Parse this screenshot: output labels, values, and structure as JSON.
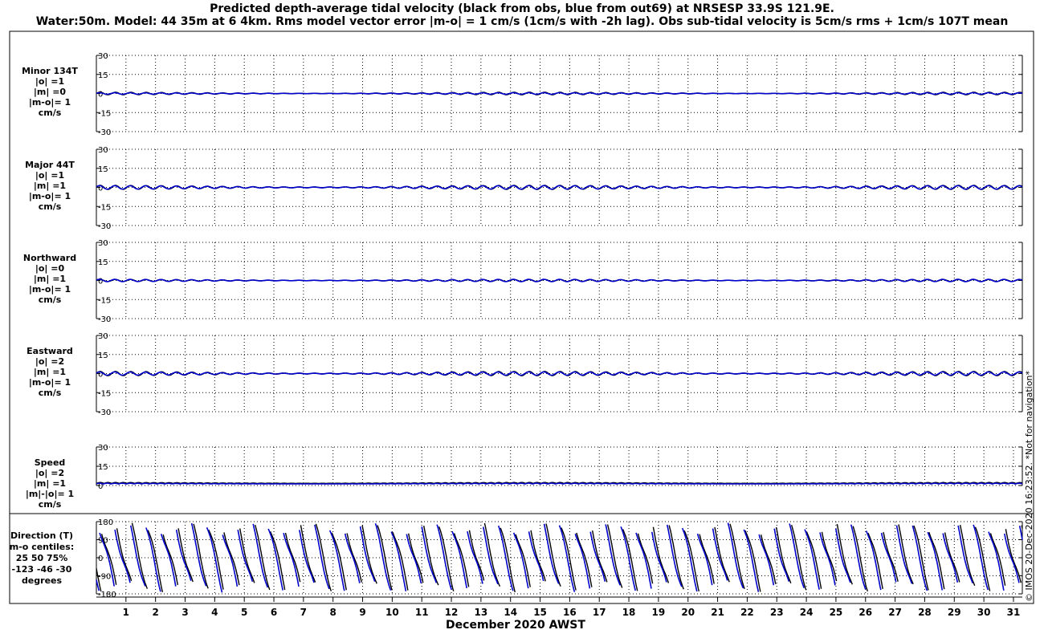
{
  "title": {
    "line1": "Predicted depth-average tidal velocity (black from obs, blue from out69) at NRSESP 33.9S 121.9E.",
    "line2": "Water:50m. Model: 44 35m at 6 4km. Rms model vector error |m-o| = 1 cm/s (1cm/s with -2h lag). Obs sub-tidal velocity is 5cm/s rms + 1cm/s 107T mean"
  },
  "credit": "© IMOS 20-Dec-2020 16:23:52. *Not for navigation*",
  "xlabel": "December 2020 AWST",
  "colors": {
    "obs": "#000000",
    "model": "#0000cc"
  },
  "chart_data": [
    {
      "type": "line",
      "name": "minor",
      "label_lines": [
        "Minor 134T",
        "|o| =1",
        "|m| =0",
        "|m-o|= 1",
        "cm/s"
      ],
      "ylim": [
        -30,
        30
      ],
      "yticks": [
        30,
        15,
        0,
        -15,
        -30
      ],
      "xlim": [
        0,
        31.3
      ],
      "series": [
        {
          "name": "obs",
          "amp": 1.0
        },
        {
          "name": "model",
          "amp": 0.6
        }
      ]
    },
    {
      "type": "line",
      "name": "major",
      "label_lines": [
        "Major 44T",
        "|o| =1",
        "|m| =1",
        "|m-o|= 1",
        "cm/s"
      ],
      "ylim": [
        -30,
        30
      ],
      "yticks": [
        30,
        15,
        0,
        -15,
        -30
      ],
      "xlim": [
        0,
        31.3
      ],
      "series": [
        {
          "name": "obs",
          "amp": 1.6
        },
        {
          "name": "model",
          "amp": 1.4
        }
      ]
    },
    {
      "type": "line",
      "name": "northward",
      "label_lines": [
        "Northward",
        "|o| =0",
        "|m| =1",
        "|m-o|= 1",
        "cm/s"
      ],
      "ylim": [
        -30,
        30
      ],
      "yticks": [
        30,
        15,
        0,
        -15,
        -30
      ],
      "xlim": [
        0,
        31.3
      ],
      "series": [
        {
          "name": "obs",
          "amp": 0.8
        },
        {
          "name": "model",
          "amp": 0.9
        }
      ]
    },
    {
      "type": "line",
      "name": "eastward",
      "label_lines": [
        "Eastward",
        "|o| =2",
        "|m| =1",
        "|m-o|= 1",
        "cm/s"
      ],
      "ylim": [
        -30,
        30
      ],
      "yticks": [
        30,
        15,
        0,
        -15,
        -30
      ],
      "xlim": [
        0,
        31.3
      ],
      "series": [
        {
          "name": "obs",
          "amp": 1.7
        },
        {
          "name": "model",
          "amp": 1.3
        }
      ]
    },
    {
      "type": "line",
      "name": "speed",
      "label_lines": [
        "Speed",
        "|o| =2",
        "|m| =1",
        "|m|-|o|= 1",
        "cm/s"
      ],
      "ylim": [
        0,
        30
      ],
      "yticks": [
        30,
        15,
        0
      ],
      "xlim": [
        0,
        31.3
      ],
      "series": [
        {
          "name": "obs",
          "amp": 1.6
        },
        {
          "name": "model",
          "amp": 1.2
        }
      ]
    },
    {
      "type": "line",
      "name": "direction",
      "label_lines": [
        "Direction (T)",
        "m-o centiles:",
        "25  50  75%",
        "-123  -46  -30",
        "degrees"
      ],
      "ylim": [
        -180,
        180
      ],
      "yticks": [
        180,
        90,
        0,
        -90,
        -180
      ],
      "xlim": [
        0,
        31.3
      ],
      "series": [
        {
          "name": "obs"
        },
        {
          "name": "model"
        }
      ]
    }
  ],
  "x_ticks": [
    "1",
    "2",
    "3",
    "4",
    "5",
    "6",
    "7",
    "8",
    "9",
    "10",
    "11",
    "12",
    "13",
    "14",
    "15",
    "16",
    "17",
    "18",
    "19",
    "20",
    "21",
    "22",
    "23",
    "24",
    "25",
    "26",
    "27",
    "28",
    "29",
    "30",
    "31"
  ]
}
